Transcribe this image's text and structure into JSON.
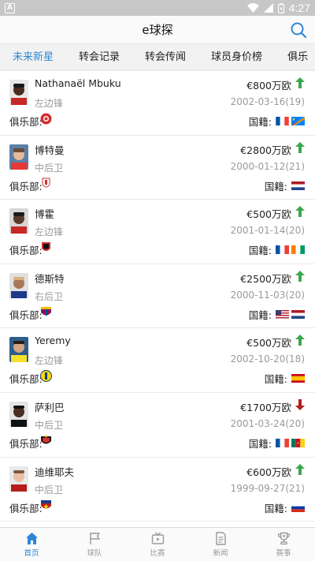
{
  "status_bar": {
    "app_badge": "A",
    "time": "4:27"
  },
  "header": {
    "title": "e球探"
  },
  "tabs": [
    {
      "label": "未来新星"
    },
    {
      "label": "转会记录"
    },
    {
      "label": "转会传闻"
    },
    {
      "label": "球员身价榜"
    },
    {
      "label": "俱乐"
    }
  ],
  "labels": {
    "club": "俱乐部:",
    "nationality": "国籍:"
  },
  "players": [
    {
      "name": "Nathanaël Mbuku",
      "position": "左边锋",
      "value": "€800万欧",
      "trend": "up",
      "dob": "2002-03-16(19)",
      "flags": [
        "france",
        "dr-congo"
      ]
    },
    {
      "name": "博特曼",
      "position": "中后卫",
      "value": "€2800万欧",
      "trend": "up",
      "dob": "2000-01-12(21)",
      "flags": [
        "netherlands"
      ]
    },
    {
      "name": "博霍",
      "position": "左边锋",
      "value": "€500万欧",
      "trend": "up",
      "dob": "2001-01-14(20)",
      "flags": [
        "france",
        "ivory-coast"
      ]
    },
    {
      "name": "德斯特",
      "position": "右后卫",
      "value": "€2500万欧",
      "trend": "up",
      "dob": "2000-11-03(20)",
      "flags": [
        "usa",
        "netherlands"
      ]
    },
    {
      "name": "Yeremy",
      "position": "左边锋",
      "value": "€500万欧",
      "trend": "up",
      "dob": "2002-10-20(18)",
      "flags": [
        "spain"
      ]
    },
    {
      "name": "萨利巴",
      "position": "中后卫",
      "value": "€1700万欧",
      "trend": "down",
      "dob": "2001-03-24(20)",
      "flags": [
        "france",
        "cameroon"
      ]
    },
    {
      "name": "迪维耶夫",
      "position": "中后卫",
      "value": "€600万欧",
      "trend": "up",
      "dob": "1999-09-27(21)",
      "flags": [
        "russia"
      ]
    }
  ],
  "bottom_nav": [
    {
      "label": "首页",
      "icon": "home-icon"
    },
    {
      "label": "球队",
      "icon": "flag-icon"
    },
    {
      "label": "比赛",
      "icon": "tv-icon"
    },
    {
      "label": "新闻",
      "icon": "news-icon"
    },
    {
      "label": "赛事",
      "icon": "trophy-icon"
    }
  ],
  "colors": {
    "accent": "#2f86d6",
    "up": "#3aa84a",
    "down": "#b51e1e"
  }
}
